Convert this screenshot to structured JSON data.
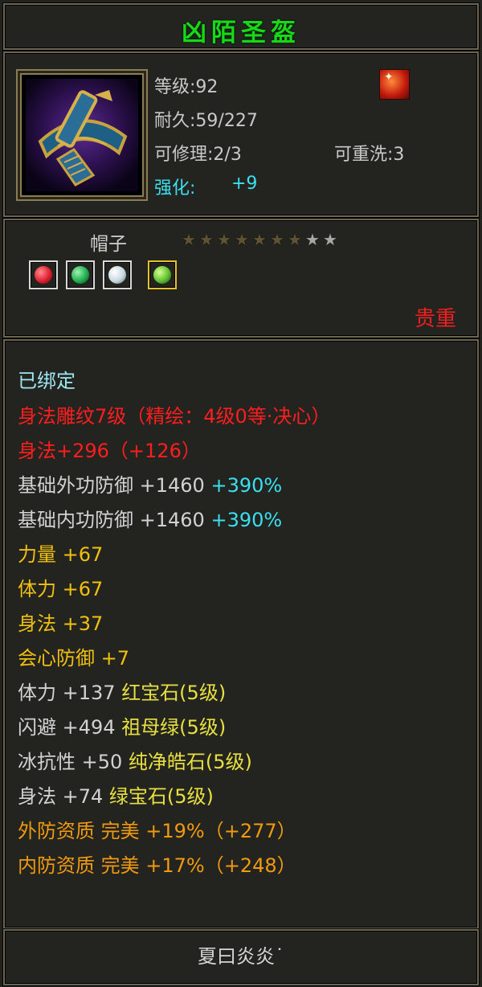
{
  "item": {
    "name": "凶陌圣盔",
    "level": "等级:92",
    "durability": "耐久:59/227",
    "repair": "可修理:2/3",
    "rewash": "可重洗:3",
    "enhance_label": "强化:",
    "enhance_value": "+9",
    "type": "帽子",
    "stars_total": 9,
    "stars_filled": 7,
    "rarity": "贵重",
    "icon": "helmet-icon"
  },
  "gems": [
    {
      "name": "ruby-gem-icon",
      "color": "#e02030",
      "selected": false
    },
    {
      "name": "emerald-gem-icon",
      "color": "#20b050",
      "selected": false
    },
    {
      "name": "diamond-gem-icon",
      "color": "#c8d8e0",
      "selected": false
    },
    {
      "name": "green-gem-icon",
      "color": "#60c030",
      "selected": true
    }
  ],
  "attributes": {
    "bound": "已绑定",
    "engrave": "身法雕纹7级（精绘：4级0等·决心）",
    "agility_main": "身法+296（+126）",
    "outer_def_label": "基础外功防御 +1460",
    "outer_def_pct": "+390%",
    "inner_def_label": "基础内功防御 +1460",
    "inner_def_pct": "+390%",
    "strength": "力量 +67",
    "stamina": "体力 +67",
    "agility": "身法 +37",
    "crit_def": "会心防御 +7",
    "gem1_stat": "体力 +137",
    "gem1_name": "红宝石(5级)",
    "gem2_stat": "闪避 +494",
    "gem2_name": "祖母绿(5级)",
    "gem3_stat": "冰抗性 +50",
    "gem3_name": "纯净皓石(5级)",
    "gem4_stat": "身法 +74",
    "gem4_name": "绿宝石(5级)",
    "outer_quality": "外防资质  完美 +19%（+277）",
    "inner_quality": "内防资质  完美 +17%（+248）"
  },
  "footer": {
    "owner": "夏曰炎炎˙"
  }
}
